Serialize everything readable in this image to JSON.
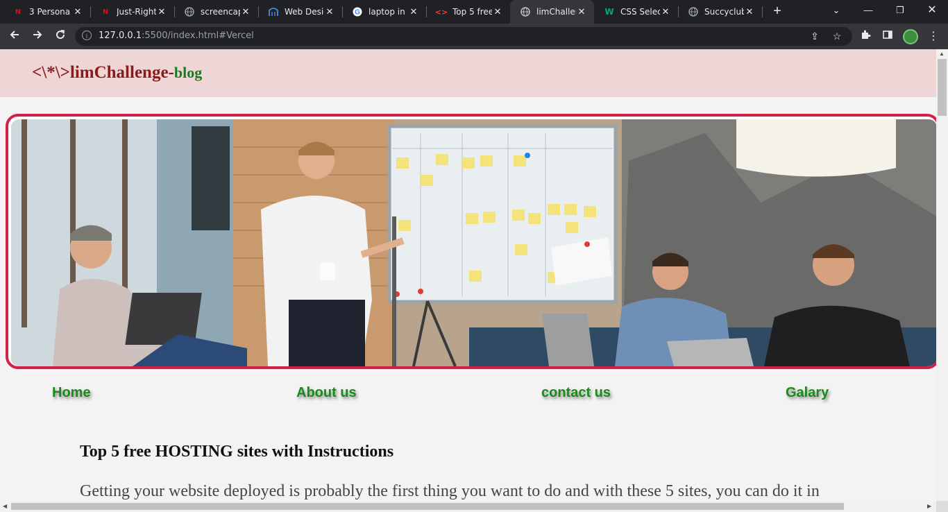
{
  "browser": {
    "tabs": [
      {
        "label": "3 Persona",
        "icon": "netflix-icon"
      },
      {
        "label": "Just-Right",
        "icon": "netflix-icon"
      },
      {
        "label": "screencapt",
        "icon": "globe-icon"
      },
      {
        "label": "Web Desig",
        "icon": "site-icon"
      },
      {
        "label": "laptop in a",
        "icon": "google-icon"
      },
      {
        "label": "Top 5 free",
        "icon": "code-icon"
      },
      {
        "label": "limChallen",
        "icon": "globe-icon"
      },
      {
        "label": "CSS Select",
        "icon": "w3schools-icon"
      },
      {
        "label": "Succyclub",
        "icon": "globe-icon"
      }
    ],
    "active_tab_index": 6,
    "url_host": "127.0.0.1",
    "url_rest": ":5500/index.html#Vercel"
  },
  "site": {
    "brand_main": "<\\*\\>limChallenge-",
    "brand_suffix": "blog",
    "hero_alt": "team meeting at a whiteboard",
    "nav": [
      "Home",
      "About us",
      "contact us",
      "Galary"
    ],
    "article_title": "Top 5 free HOSTING sites with Instructions",
    "article_text": "Getting your website deployed is probably the first thing you want to do and with these 5 sites, you can do it in"
  },
  "colors": {
    "brand": "#8b1a1a",
    "brand_suffix": "#1e7a1e",
    "header_bg": "#efd6d6",
    "hero_border": "#d32047",
    "nav_link": "#1a8a1a"
  }
}
